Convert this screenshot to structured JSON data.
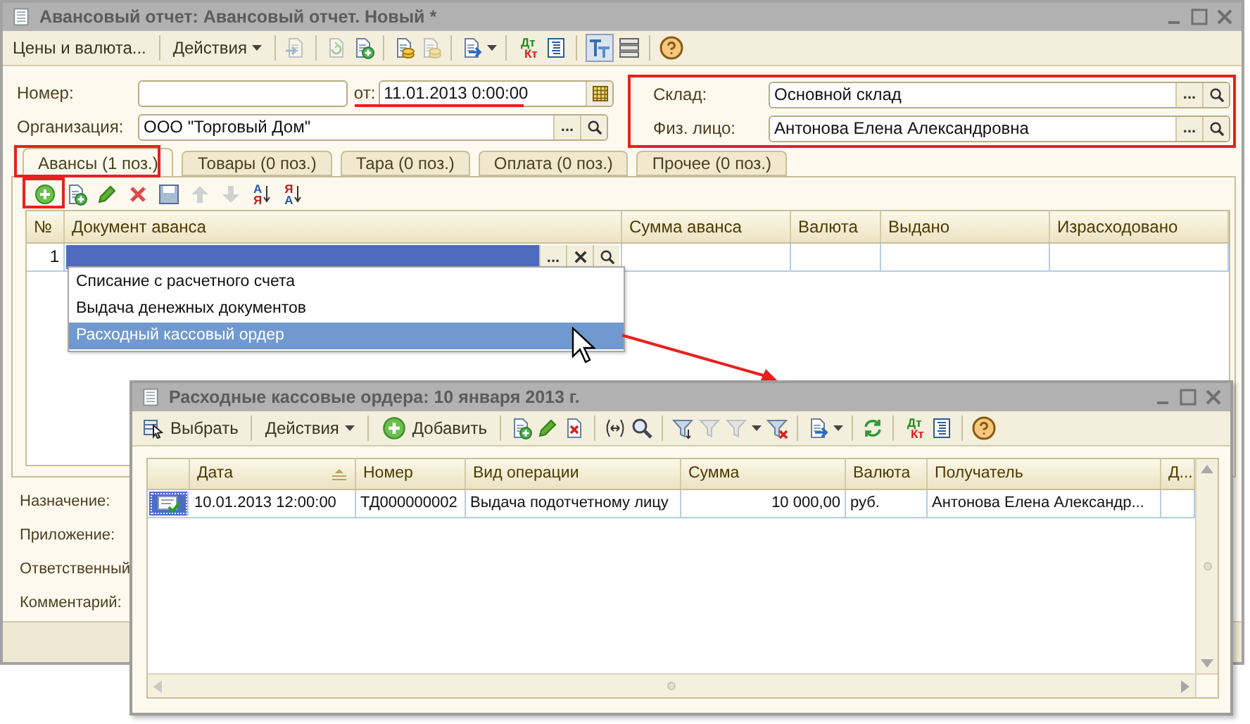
{
  "window": {
    "title": "Авансовый отчет: Авансовый отчет. Новый *",
    "toolbar": [
      {
        "kind": "text",
        "label": "Цены и валюта..."
      },
      {
        "kind": "separator"
      },
      {
        "kind": "menu",
        "label": "Действия"
      },
      {
        "kind": "separator"
      },
      {
        "kind": "post",
        "disabled": true
      },
      {
        "kind": "separator"
      },
      {
        "kind": "refresh-doc",
        "disabled": true
      },
      {
        "kind": "doc-add",
        "disabled": false
      },
      {
        "kind": "separator"
      },
      {
        "kind": "doc-coins",
        "disabled": false
      },
      {
        "kind": "doc-coins",
        "disabled": true
      },
      {
        "kind": "separator"
      },
      {
        "kind": "export",
        "disabled": false,
        "has_menu": true
      },
      {
        "kind": "separator"
      },
      {
        "kind": "dtkt",
        "top": "Дт",
        "bottom": "Кт"
      },
      {
        "kind": "report",
        "disabled": false
      },
      {
        "kind": "separator"
      },
      {
        "kind": "structure",
        "disabled": false,
        "pressed": true
      },
      {
        "kind": "rows",
        "disabled": false
      },
      {
        "kind": "separator"
      },
      {
        "kind": "help",
        "disabled": false
      }
    ]
  },
  "number_field": {
    "label": "Номер:"
  },
  "date_field": {
    "label": "от:",
    "value": "11.01.2013  0:00:00"
  },
  "organization_field": {
    "label": "Организация:",
    "value": "ООО \"Торговый Дом\"",
    "choose_button": "..."
  },
  "warehouse_field": {
    "label": "Склад:",
    "value": "Основной склад",
    "choose_button": "..."
  },
  "person_field": {
    "label": "Физ. лицо:",
    "value": "Антонова Елена Александровна",
    "choose_button": "..."
  },
  "tabs": [
    {
      "label": "Авансы (1 поз.)",
      "selected": true
    },
    {
      "label": "Товары (0 поз.)",
      "selected": false
    },
    {
      "label": "Тара (0 поз.)",
      "selected": false
    },
    {
      "label": "Оплата (0 поз.)",
      "selected": false
    },
    {
      "label": "Прочее (0 поз.)",
      "selected": false
    }
  ],
  "tab_toolbar": [
    {
      "kind": "add",
      "disabled": false
    },
    {
      "kind": "doc-add",
      "disabled": false
    },
    {
      "kind": "edit",
      "disabled": false
    },
    {
      "kind": "delete",
      "disabled": false
    },
    {
      "kind": "save",
      "disabled": false
    },
    {
      "kind": "up",
      "disabled": true
    },
    {
      "kind": "down",
      "disabled": true
    },
    {
      "kind": "sort-asc",
      "top": "А",
      "bottom": "Я"
    },
    {
      "kind": "sort-desc",
      "top": "Я",
      "bottom": "А"
    }
  ],
  "advances_table": {
    "columns": [
      {
        "label": "№",
        "kind": "number"
      },
      {
        "label": "Документ аванса",
        "kind": "document"
      },
      {
        "label": "Сумма аванса",
        "kind": "amount"
      },
      {
        "label": "Валюта",
        "kind": "text"
      },
      {
        "label": "Выдано",
        "kind": "text"
      },
      {
        "label": "Израсходовано",
        "kind": "text"
      }
    ],
    "rows": [
      {
        "number": "1",
        "editing": true,
        "choose_button": "..."
      }
    ]
  },
  "dropdown": {
    "items": [
      {
        "label": "Списание с расчетного счета",
        "selected": false
      },
      {
        "label": "Выдача денежных документов",
        "selected": false
      },
      {
        "label": "Расходный кассовый ордер",
        "selected": true
      }
    ]
  },
  "bottom_labels": [
    "Назначение:",
    "Приложение:",
    "Ответственный",
    "Комментарий:"
  ],
  "list_window": {
    "title": "Расходные кассовые ордера: 10 января 2013 г.",
    "toolbar": [
      {
        "kind": "select",
        "label": "Выбрать"
      },
      {
        "kind": "separator"
      },
      {
        "kind": "menu",
        "label": "Действия"
      },
      {
        "kind": "separator"
      },
      {
        "kind": "add-text",
        "label": "Добавить"
      },
      {
        "kind": "separator"
      },
      {
        "kind": "doc-add",
        "disabled": false
      },
      {
        "kind": "edit",
        "disabled": false
      },
      {
        "kind": "doc-delete",
        "disabled": false
      },
      {
        "kind": "separator"
      },
      {
        "kind": "interval",
        "disabled": false
      },
      {
        "kind": "find",
        "disabled": false
      },
      {
        "kind": "separator"
      },
      {
        "kind": "filter-set",
        "disabled": false
      },
      {
        "kind": "filter",
        "disabled": true
      },
      {
        "kind": "filter",
        "disabled": true,
        "has_menu": true
      },
      {
        "kind": "filter-clear",
        "disabled": false
      },
      {
        "kind": "separator"
      },
      {
        "kind": "export",
        "disabled": false,
        "has_menu": true
      },
      {
        "kind": "separator"
      },
      {
        "kind": "refresh",
        "disabled": false
      },
      {
        "kind": "separator"
      },
      {
        "kind": "dtkt",
        "top": "Дт",
        "bottom": "Кт"
      },
      {
        "kind": "report",
        "disabled": false
      },
      {
        "kind": "separator"
      },
      {
        "kind": "help",
        "disabled": false
      }
    ],
    "table": {
      "columns": [
        {
          "kind": "icon",
          "sorted": false
        },
        {
          "label": "Дата",
          "kind": "text",
          "sorted": true
        },
        {
          "label": "Номер",
          "kind": "text",
          "sorted": false
        },
        {
          "label": "Вид операции",
          "kind": "text",
          "sorted": false
        },
        {
          "label": "Сумма",
          "kind": "amount",
          "sorted": false
        },
        {
          "label": "Валюта",
          "kind": "text",
          "sorted": false
        },
        {
          "label": "Получатель",
          "kind": "text",
          "sorted": false
        },
        {
          "label": "Д...",
          "kind": "text",
          "sorted": false
        }
      ],
      "rows": [
        {
          "selected": true,
          "cells": [
            "",
            "10.01.2013 12:00:00",
            "ТД000000002",
            "Выдача подотчетному лицу",
            "10 000,00",
            "руб.",
            "Антонова Елена Александр..."
          ]
        }
      ]
    }
  }
}
